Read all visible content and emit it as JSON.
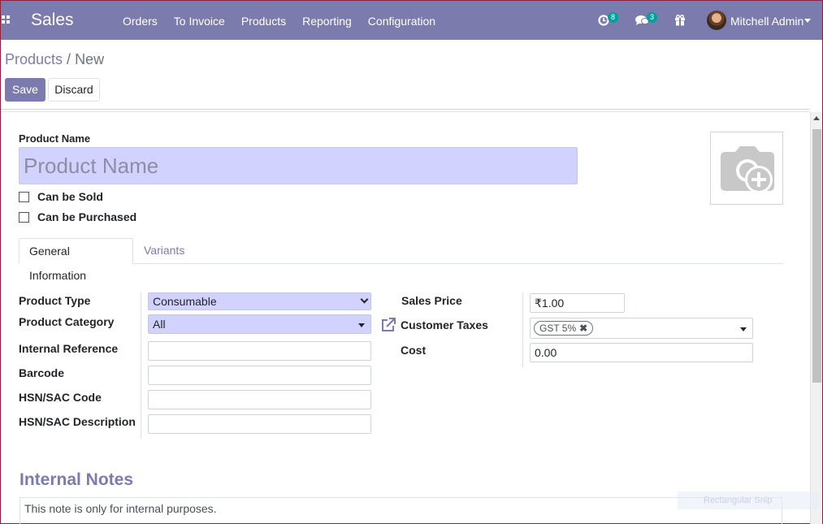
{
  "navbar": {
    "app_name": "Sales",
    "menu": [
      "Orders",
      "To Invoice",
      "Products",
      "Reporting",
      "Configuration"
    ],
    "activity_count": "8",
    "messages_count": "3",
    "user_name": "Mitchell Admin"
  },
  "control_panel": {
    "breadcrumb_parent": "Products",
    "breadcrumb_separator": "/",
    "breadcrumb_current": "New",
    "save_label": "Save",
    "discard_label": "Discard"
  },
  "form": {
    "product_name_label": "Product Name",
    "product_name_placeholder": "Product Name",
    "can_be_sold_label": "Can be Sold",
    "can_be_purchased_label": "Can be Purchased",
    "tabs": [
      "General Information",
      "Variants"
    ],
    "left_fields": {
      "product_type_label": "Product Type",
      "product_type_value": "Consumable",
      "product_category_label": "Product Category",
      "product_category_value": "All",
      "internal_reference_label": "Internal Reference",
      "barcode_label": "Barcode",
      "hsn_code_label": "HSN/SAC Code",
      "hsn_description_label": "HSN/SAC Description"
    },
    "right_fields": {
      "sales_price_label": "Sales Price",
      "sales_price_value": "₹1.00",
      "customer_taxes_label": "Customer Taxes",
      "customer_taxes_tag": "GST 5%",
      "cost_label": "Cost",
      "cost_value": "0.00"
    },
    "internal_notes_title": "Internal Notes",
    "internal_notes_placeholder": "This note is only for internal purposes."
  },
  "overlay": {
    "snip_label": "Rectangular Snip"
  },
  "colors": {
    "brand": "#7c7bad",
    "required_field": "#d2d2ff",
    "badge": "#00a09d"
  }
}
